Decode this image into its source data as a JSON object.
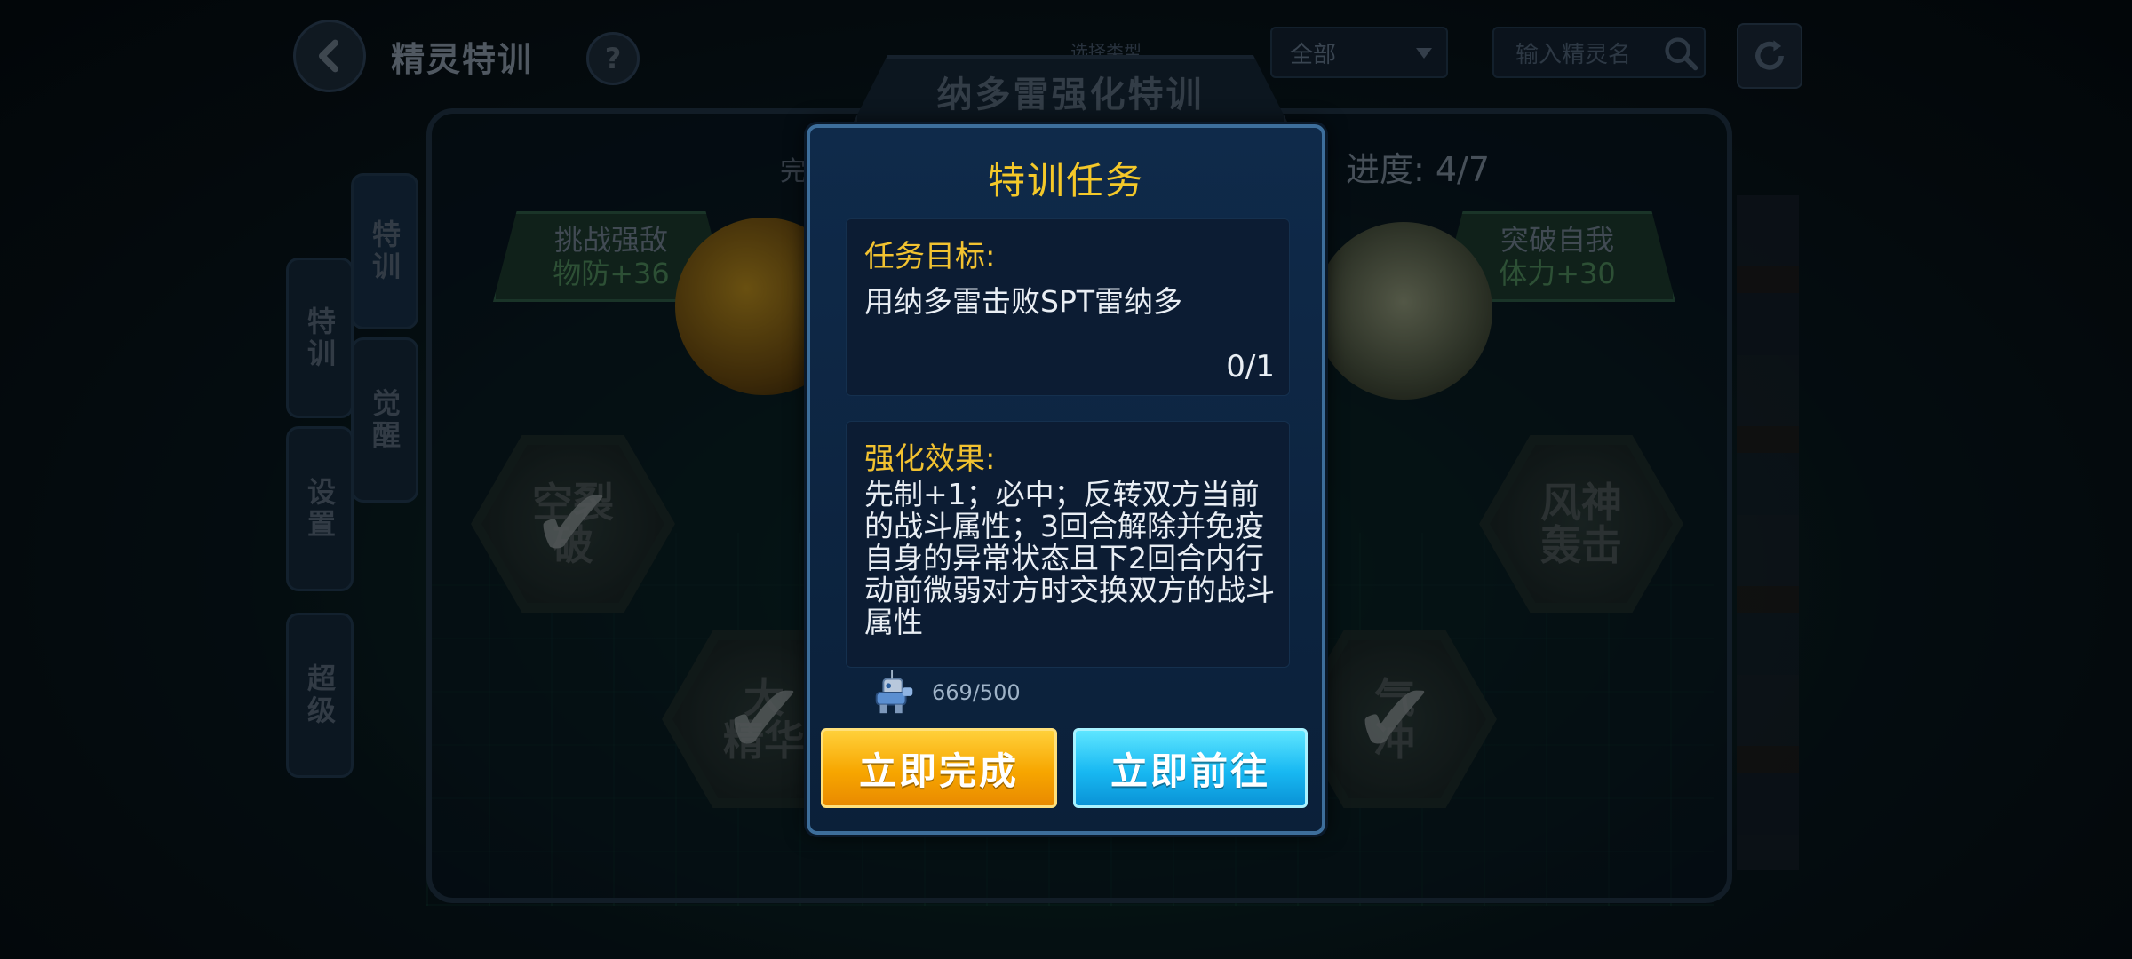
{
  "background": {
    "page_title": "精灵特训",
    "help_label": "?",
    "filter_label": "选择类型",
    "filter_selected": "全部",
    "search_placeholder": "输入精灵名",
    "panel_title": "纳多雷强化特训",
    "progress_text": "进度: 4/7",
    "completed_stub": "完",
    "side_tabs": [
      "特训",
      "觉醒",
      "特训",
      "设置",
      "超级"
    ],
    "banner_left": {
      "title": "挑战强敌",
      "bonus": "物防+36"
    },
    "banner_right": {
      "title": "突破自我",
      "bonus": "体力+30"
    },
    "skills": [
      {
        "line1": "空裂",
        "line2": "破"
      },
      {
        "line1": "风神",
        "line2": "轰击"
      },
      {
        "line1": "大",
        "line2": "精华"
      },
      {
        "line1": "气",
        "line2": "冲"
      }
    ]
  },
  "dialog": {
    "title": "特训任务",
    "goal_heading": "任务目标:",
    "goal_text": "用纳多雷击败SPT雷纳多",
    "goal_progress": "0/1",
    "effect_heading": "强化效果:",
    "effect_text": "先制+1；必中；反转双方当前的战斗属性；3回合解除并免疫自身的异常状态且下2回合内行动前微弱对方时交换双方的战斗属性",
    "cost_icon": "robot-item-icon",
    "cost_text": "669/500",
    "complete_button": "立即完成",
    "goto_button": "立即前往"
  },
  "colors": {
    "dialog_title": "#f4c829",
    "heading": "#f2c230",
    "complete_button": "#f7a600",
    "goto_button": "#18b8f2"
  }
}
